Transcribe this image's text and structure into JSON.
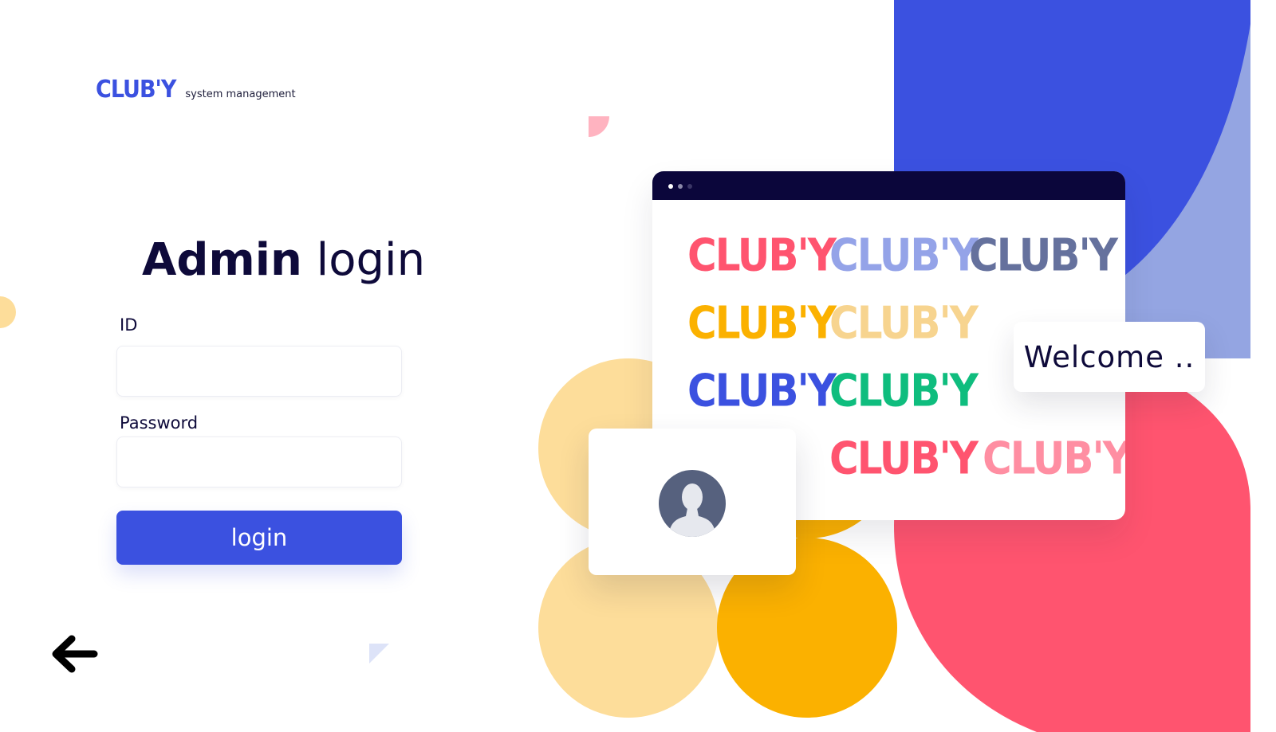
{
  "brand": {
    "logo_text": "CLUB'Y",
    "tagline": "system management"
  },
  "login": {
    "title_bold": "Admin",
    "title_light": "login",
    "id_label": "ID",
    "id_value": "",
    "password_label": "Password",
    "password_value": "",
    "submit_label": "login"
  },
  "navigation": {
    "back_icon": "arrow-left-icon"
  },
  "illustration": {
    "logo_text": "CLUB'Y",
    "logos": [
      {
        "color": "#ff546f"
      },
      {
        "color": "#94a3e8"
      },
      {
        "color": "#65719d"
      },
      {
        "color": "#fbb100"
      },
      {
        "color": "#f7d48f"
      },
      {
        "color": "#3b51e0"
      },
      {
        "color": "#0fbd7e"
      },
      {
        "color": "#ff546f"
      },
      {
        "color": "#ff8ea2"
      }
    ],
    "welcome_text": "Welcome ..",
    "avatar_icon": "user-avatar-icon"
  },
  "colors": {
    "accent": "#3b51e0",
    "dark": "#0b063b",
    "coral": "#ff546f",
    "amber": "#fbb100",
    "sand": "#fddd9a",
    "periwinkle": "#94a5e2"
  }
}
